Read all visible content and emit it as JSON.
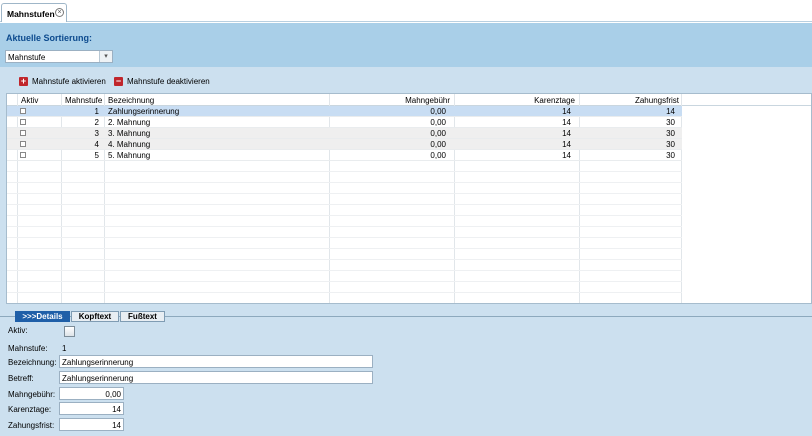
{
  "tab": {
    "title": "Mahnstufen"
  },
  "sort": {
    "title": "Aktuelle Sortierung:",
    "selected": "Mahnstufe"
  },
  "toolbar": {
    "activate": "Mahnstufe aktivieren",
    "deactivate": "Mahnstufe deaktivieren"
  },
  "grid": {
    "headers": [
      "Aktiv",
      "Mahnstufe",
      "Bezeichnung",
      "Mahngebühr",
      "Karenztage",
      "Zahungsfrist"
    ],
    "rows": [
      {
        "stufe": "1",
        "bez": "Zahlungserinnerung",
        "gebuehr": "0,00",
        "karenz": "14",
        "frist": "14"
      },
      {
        "stufe": "2",
        "bez": "2. Mahnung",
        "gebuehr": "0,00",
        "karenz": "14",
        "frist": "30"
      },
      {
        "stufe": "3",
        "bez": "3. Mahnung",
        "gebuehr": "0,00",
        "karenz": "14",
        "frist": "30"
      },
      {
        "stufe": "4",
        "bez": "4. Mahnung",
        "gebuehr": "0,00",
        "karenz": "14",
        "frist": "30"
      },
      {
        "stufe": "5",
        "bez": "5. Mahnung",
        "gebuehr": "0,00",
        "karenz": "14",
        "frist": "30"
      }
    ]
  },
  "detail_tabs": [
    ">>>Details",
    "Kopftext",
    "Fußtext"
  ],
  "details": {
    "aktiv_label": "Aktiv:",
    "stufe_label": "Mahnstufe:",
    "stufe_value": "1",
    "bez_label": "Bezeichnung:",
    "bez_value": "Zahlungserinnerung",
    "betreff_label": "Betreff:",
    "betreff_value": "Zahlungserinnerung",
    "gebuehr_label": "Mahngebühr:",
    "gebuehr_value": "0,00",
    "karenz_label": "Karenztage:",
    "karenz_value": "14",
    "frist_label": "Zahungsfrist:",
    "frist_value": "14"
  }
}
